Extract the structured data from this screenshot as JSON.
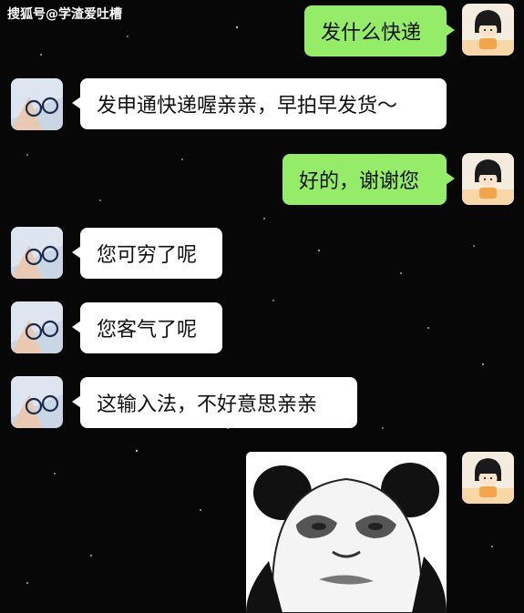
{
  "watermark": "搜狐号@学渣爱吐槽",
  "messages": [
    {
      "side": "right",
      "text": "发什么快递",
      "avatar": "girl-cartoon-avatar"
    },
    {
      "side": "left",
      "text": "发申通快递喔亲亲，早拍早发货～",
      "avatar": "glasses-photo-avatar"
    },
    {
      "side": "right",
      "text": "好的，谢谢您",
      "avatar": "girl-cartoon-avatar"
    },
    {
      "side": "left",
      "text": "您可穷了呢",
      "avatar": "glasses-photo-avatar"
    },
    {
      "side": "left",
      "text": "您客气了呢",
      "avatar": "glasses-photo-avatar"
    },
    {
      "side": "left",
      "text": "这输入法，不好意思亲亲",
      "avatar": "glasses-photo-avatar"
    },
    {
      "side": "right",
      "type": "sticker",
      "sticker": "panda-meme-sticker",
      "avatar": "girl-cartoon-avatar"
    }
  ],
  "colors": {
    "background": "#070707",
    "bubble_self": "#95ec69",
    "bubble_other": "#ffffff"
  }
}
